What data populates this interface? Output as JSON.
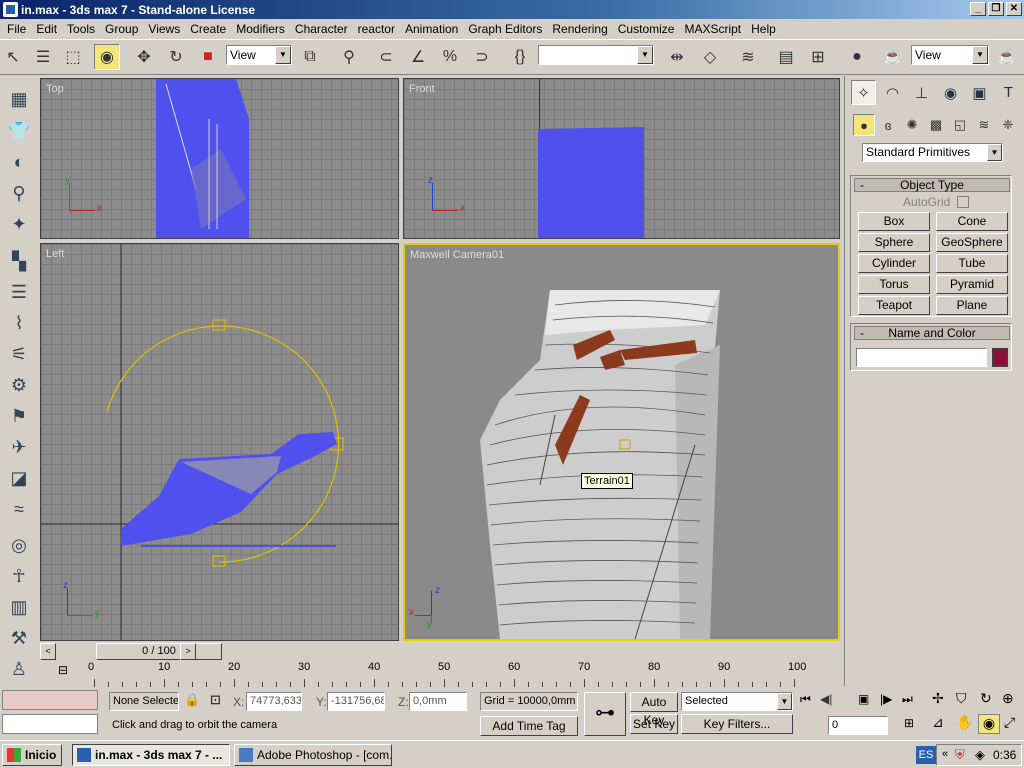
{
  "window": {
    "title": "in.max - 3ds max 7 - Stand-alone License",
    "min": "_",
    "max": "❐",
    "close": "✕"
  },
  "menu": [
    "File",
    "Edit",
    "Tools",
    "Group",
    "Views",
    "Create",
    "Modifiers",
    "Character",
    "reactor",
    "Animation",
    "Graph Editors",
    "Rendering",
    "Customize",
    "MAXScript",
    "Help"
  ],
  "toolbar": {
    "ref_coord": "View",
    "named_sel": "",
    "render_view": "View"
  },
  "viewports": {
    "top": {
      "label": "Top"
    },
    "front": {
      "label": "Front"
    },
    "left": {
      "label": "Left"
    },
    "camera": {
      "label": "Maxwell Camera01",
      "tooltip": "Terrain01"
    }
  },
  "axis": {
    "x": "x",
    "y": "y",
    "z": "z"
  },
  "command_panel": {
    "category": "Standard Primitives",
    "object_type": {
      "header": "Object Type",
      "autogrid": "AutoGrid",
      "buttons": [
        "Box",
        "Cone",
        "Sphere",
        "GeoSphere",
        "Cylinder",
        "Tube",
        "Torus",
        "Pyramid",
        "Teapot",
        "Plane"
      ]
    },
    "name_color": {
      "header": "Name and Color",
      "name_value": "",
      "color": "#8b0f3a"
    }
  },
  "time": {
    "slider": "0 / 100",
    "ticks": [
      "0",
      "10",
      "20",
      "30",
      "40",
      "50",
      "60",
      "70",
      "80",
      "90",
      "100"
    ]
  },
  "status": {
    "selection": "None Selecte",
    "x_label": "X:",
    "x_value": "74773,633",
    "y_label": "Y:",
    "y_value": "-131756,68",
    "z_label": "Z:",
    "z_value": "0,0mm",
    "grid": "Grid = 10000,0mm",
    "prompt": "Click and drag to orbit the camera",
    "add_time_tag": "Add Time Tag",
    "auto_key": "Auto Key",
    "set_key": "Set Key",
    "selected": "Selected",
    "key_filters": "Key Filters...",
    "frame": "0"
  },
  "taskbar": {
    "start": "Inicio",
    "items": [
      "in.max - 3ds max 7 - ...",
      "Adobe Photoshop - [com..."
    ],
    "lang": "ES",
    "clock": "0:36"
  }
}
